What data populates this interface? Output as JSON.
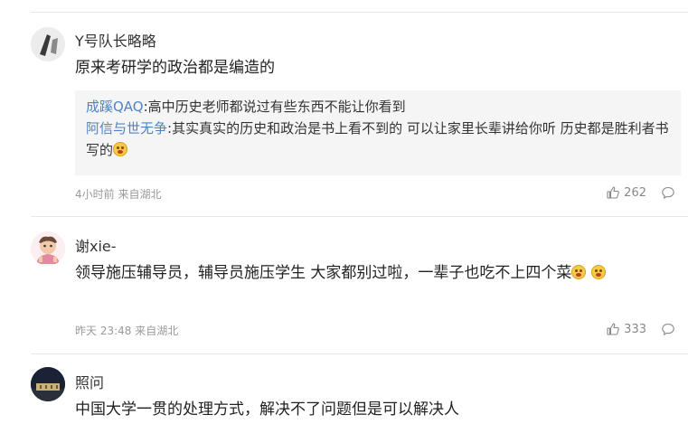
{
  "comments": [
    {
      "username": "Y号队长略略",
      "content": "原来考研学的政治都是编造的",
      "replies": [
        {
          "user": "成蹊QAQ",
          "text": ":高中历史老师都说过有些东西不能让你看到"
        },
        {
          "user": "阿信与世无争",
          "text": ":其实真实的历史和政治是书上看不到的 可以让家里长辈讲给你听 历史都是胜利者书写的"
        }
      ],
      "meta": "4小时前 来自湖北",
      "likes": "262"
    },
    {
      "username": "谢xie-",
      "content": "领导施压辅导员，辅导员施压学生 大家都别过啦，一辈子也吃不上四个菜",
      "meta": "昨天 23:48 来自湖北",
      "likes": "333"
    },
    {
      "username": "照问",
      "content": "中国大学一贯的处理方式，解决不了问题但是可以解决人"
    }
  ],
  "icons": {
    "like": "thumbs-up-icon",
    "reply": "comment-bubble-icon",
    "emoji": "blushing-emoji-icon"
  },
  "colors": {
    "reply_user": "#4f84c4",
    "meta": "#9a9a9a",
    "reply_bg": "#f5f5f5"
  }
}
